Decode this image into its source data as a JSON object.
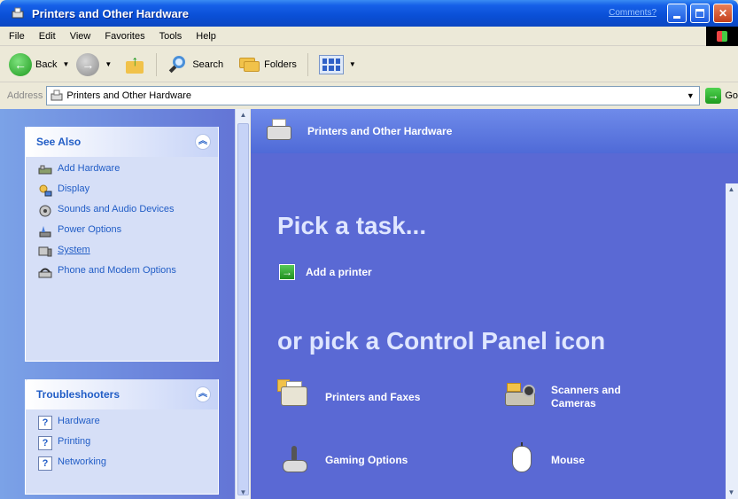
{
  "window": {
    "title": "Printers and Other Hardware",
    "comments_link": "Comments?"
  },
  "menu": {
    "items": [
      {
        "label": "File",
        "mnemonic": "F"
      },
      {
        "label": "Edit",
        "mnemonic": "E"
      },
      {
        "label": "View",
        "mnemonic": "V"
      },
      {
        "label": "Favorites",
        "mnemonic": "a"
      },
      {
        "label": "Tools",
        "mnemonic": "T"
      },
      {
        "label": "Help",
        "mnemonic": "H"
      }
    ]
  },
  "toolbar": {
    "back_label": "Back",
    "search_label": "Search",
    "folders_label": "Folders"
  },
  "address": {
    "label": "Address",
    "value": "Printers and Other Hardware",
    "go_label": "Go"
  },
  "see_also": {
    "title": "See Also",
    "items": [
      {
        "label": "Add Hardware",
        "icon": "add-hardware-icon"
      },
      {
        "label": "Display",
        "icon": "display-icon"
      },
      {
        "label": "Sounds and Audio Devices",
        "icon": "sounds-icon"
      },
      {
        "label": "Power Options",
        "icon": "power-icon"
      },
      {
        "label": "System",
        "icon": "system-icon"
      },
      {
        "label": "Phone and Modem Options",
        "icon": "phone-icon"
      }
    ]
  },
  "troubleshooters": {
    "title": "Troubleshooters",
    "items": [
      {
        "label": "Hardware",
        "icon": "help-icon"
      },
      {
        "label": "Printing",
        "icon": "help-icon"
      },
      {
        "label": "Networking",
        "icon": "help-icon"
      }
    ]
  },
  "content": {
    "title": "Printers and Other Hardware",
    "task_heading": "Pick a task...",
    "tasks": [
      {
        "label": "Add a printer",
        "icon": "add-task-icon"
      }
    ],
    "cp_heading": "or pick a Control Panel icon",
    "cp_items": [
      {
        "label": "Printers and Faxes",
        "icon": "printers-faxes-icon"
      },
      {
        "label": "Scanners and Cameras",
        "icon": "scanners-cameras-icon"
      },
      {
        "label": "Gaming Options",
        "icon": "gaming-options-icon"
      },
      {
        "label": "Mouse",
        "icon": "mouse-icon"
      }
    ]
  },
  "colors": {
    "title_bar": "#0b4fd6",
    "left_pane": "#6f8fe0",
    "content_bg": "#5a69d4",
    "link": "#215dc6"
  }
}
